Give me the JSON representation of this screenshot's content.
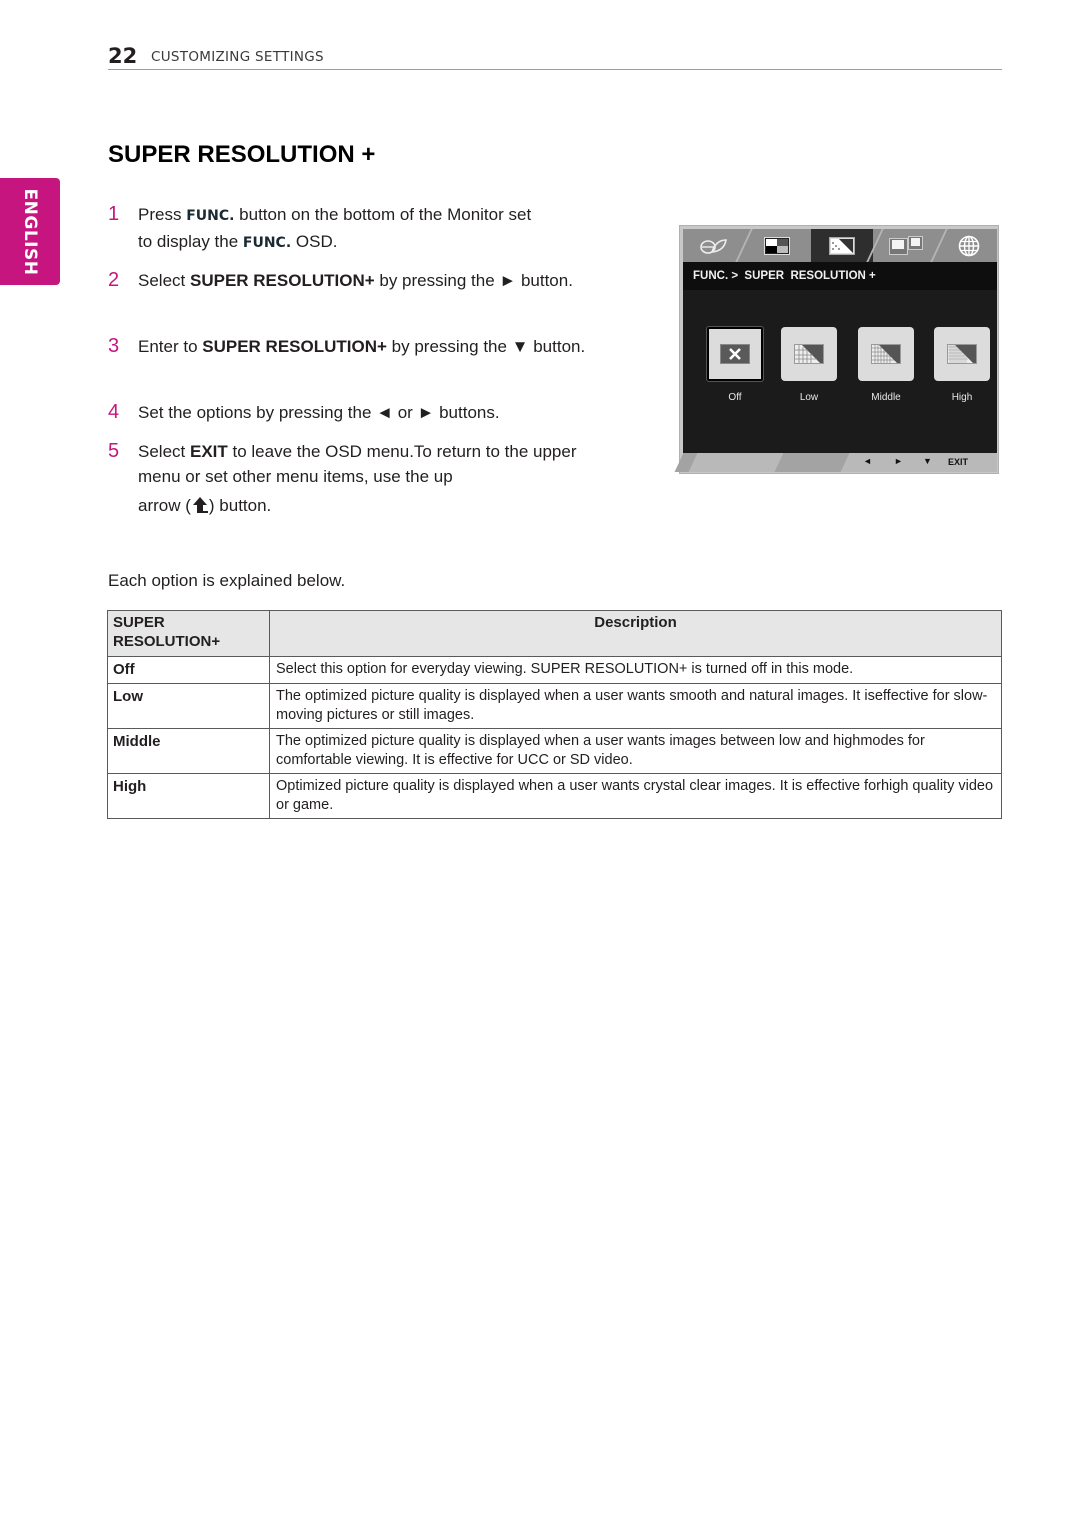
{
  "header": {
    "page_number": "22",
    "section": "CUSTOMIZING SETTINGS"
  },
  "language_tab": "ENGLISH",
  "title": "SUPER RESOLUTION +",
  "steps": [
    {
      "num": "1",
      "parts": [
        "Press ",
        "FUNC.",
        " button on   the bottom of the Monitor set to display the ",
        "FUNC.",
        " OSD."
      ]
    },
    {
      "num": "2",
      "pre": "Select ",
      "bold": "SUPER RESOLUTION+",
      "post": " by pressing the ► button."
    },
    {
      "num": "3",
      "pre": "Enter to ",
      "bold": "SUPER RESOLUTION+",
      "post": " by pressing the ▼ button."
    },
    {
      "num": "4",
      "text": "Set the options by pressing the ◄ or ► buttons."
    },
    {
      "num": "5",
      "pre": "Select ",
      "bold": "EXIT",
      "post": " to leave the OSD menu.To return to the upper menu or set other menu items, use  the up",
      "line3_pre": "arrow (",
      "line3_post": ") button.",
      "icon": "up-arrow-icon"
    }
  ],
  "step1": {
    "a": "Press ",
    "func1": "FUNC.",
    "b": " button on   the bottom of the Monitor set",
    "c": "to display the ",
    "func2": "FUNC.",
    "d": " OSD."
  },
  "intro": "Each option is explained below.",
  "osd": {
    "tabs": [
      {
        "icon": "eco-leaf-icon",
        "active": false
      },
      {
        "icon": "picture-mode-icon",
        "active": false
      },
      {
        "icon": "super-resolution-icon",
        "active": true
      },
      {
        "icon": "dual-screen-icon",
        "active": false
      },
      {
        "icon": "globe-language-icon",
        "active": false
      }
    ],
    "breadcrumb": "FUNC. >  SUPER  RESOLUTION +",
    "options": [
      {
        "label": "Off",
        "icon": "off-x-icon",
        "selected": true
      },
      {
        "label": "Low",
        "icon": "sr-low-icon",
        "selected": false
      },
      {
        "label": "Middle",
        "icon": "sr-middle-icon",
        "selected": false
      },
      {
        "label": "High",
        "icon": "sr-high-icon",
        "selected": false
      }
    ],
    "buttons": {
      "left": "◄",
      "right": "►",
      "down": "▼",
      "exit": "EXIT"
    }
  },
  "table": {
    "headers": [
      "SUPER RESOLUTION+",
      "Description"
    ],
    "header_line1": "SUPER",
    "header_line2": "RESOLUTION+",
    "rows": [
      {
        "option": "Off",
        "description": "Select this option for everyday viewing. SUPER RESOLUTION+  is turned off in this mode."
      },
      {
        "option": "Low",
        "description": "The optimized picture quality is displayed when a user wants smooth and natural images. It iseffective for slow-moving pictures or still images."
      },
      {
        "option": "Middle",
        "description": "The optimized picture quality is displayed when a user wants images between low and highmodes for comfortable viewing. It is effective for UCC or SD video."
      },
      {
        "option": "High",
        "description": "Optimized picture quality is displayed when a user wants crystal clear images. It is effective forhigh quality video or game."
      }
    ]
  },
  "colors": {
    "accent": "#c7157f",
    "header_rule": "#e873b4",
    "table_header_bg": "#e6e6e6",
    "osd_screen": "#1b1b1b"
  }
}
